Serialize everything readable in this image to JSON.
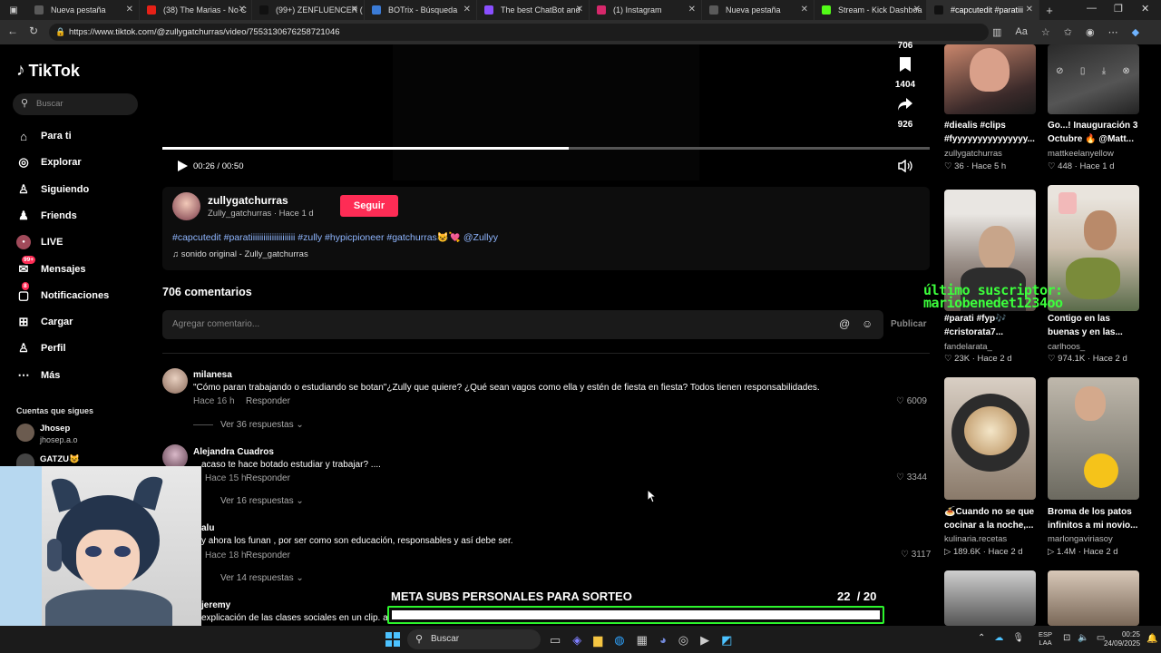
{
  "browser": {
    "tabs": [
      {
        "label": "Nueva pestaña",
        "color": "#5a5a5a"
      },
      {
        "label": "(38) The Marias - No C",
        "color": "#e62117"
      },
      {
        "label": "(99+) ZENFLUENCER (",
        "color": "#111111"
      },
      {
        "label": "BOTrix - Búsqueda",
        "color": "#3b7bd6"
      },
      {
        "label": "The best ChatBot and",
        "color": "#8a4fff"
      },
      {
        "label": "(1) Instagram",
        "color": "#d6286b"
      },
      {
        "label": "Nueva pestaña",
        "color": "#5a5a5a"
      },
      {
        "label": "Stream - Kick Dashboa",
        "color": "#53fc18"
      },
      {
        "label": "#capcutedit #paratiii",
        "color": "#111111"
      }
    ],
    "url": "https://www.tiktok.com/@zullygatchurras/video/7553130676258721046"
  },
  "sidebar": {
    "logo": "TikTok",
    "search_placeholder": "Buscar",
    "items": [
      {
        "label": "Para ti",
        "icon": "home-icon"
      },
      {
        "label": "Explorar",
        "icon": "compass-icon"
      },
      {
        "label": "Siguiendo",
        "icon": "following-icon"
      },
      {
        "label": "Friends",
        "icon": "friends-icon"
      },
      {
        "label": "LIVE",
        "icon": "live-icon"
      },
      {
        "label": "Mensajes",
        "icon": "messages-icon",
        "badge": "99+"
      },
      {
        "label": "Notificaciones",
        "icon": "notifications-icon",
        "badge": "8"
      },
      {
        "label": "Cargar",
        "icon": "upload-icon"
      },
      {
        "label": "Perfil",
        "icon": "profile-icon"
      },
      {
        "label": "Más",
        "icon": "more-icon"
      }
    ],
    "following_header": "Cuentas que sigues",
    "following": [
      {
        "name": "Jhosep",
        "handle": "jhosep.a.o"
      },
      {
        "name": "GATZU😺",
        "handle": ""
      }
    ]
  },
  "video": {
    "time_current": "00:26",
    "time_total": "00:50",
    "progress": 0.53,
    "side_counts": {
      "top": "706",
      "bookmarks": "1404",
      "shares": "926"
    }
  },
  "post": {
    "author": "zullygatchurras",
    "subline": "Zully_gatchurras · Hace 1 d",
    "follow_label": "Seguir",
    "caption": "#capcutedit #paratiiiiiiiiiiiiiiiiiiiii #zully #hypicpioneer #gatchurras😺💘 @Zullyy",
    "sound": "sonido original - Zully_gatchurras"
  },
  "comments": {
    "header": "706 comentarios",
    "input_placeholder": "Agregar comentario...",
    "publish_label": "Publicar",
    "reply_label": "Responder",
    "items": [
      {
        "name": "milanesa",
        "text": "\"Cómo paran trabajando o estudiando se botan\"¿Zully que quiere? ¿Qué sean vagos como ella y estén de fiesta en fiesta? Todos tienen responsabilidades.",
        "time": "Hace 16 h",
        "likes": "6009",
        "replies": "Ver 36 respuestas"
      },
      {
        "name": "Alejandra Cuadros",
        "text": "acaso te hace botado estudiar y trabajar? ....",
        "time": "Hace 15 h",
        "likes": "3344",
        "replies": "Ver 16 respuestas"
      },
      {
        "name": "alu",
        "text": "y ahora los funan , por ser como son educación, responsables y así debe ser.",
        "time": "Hace 18 h",
        "likes": "3117",
        "replies": "Ver 14 respuestas"
      },
      {
        "name": "jeremy",
        "text": "explicación de las clases sociales en un clip. ahí entendemos su la gente con clase Brisero no mezclada · toda la razón",
        "time": "",
        "likes": "",
        "replies": ""
      }
    ]
  },
  "related": [
    {
      "title": "#diealis #clips #fyyyyyyyyyyyyyyy...",
      "author": "zullygatchurras",
      "views": "36",
      "age": "Hace 5 h"
    },
    {
      "title": "Go...! Inauguración 3 Octubre 🔥 @Matt...",
      "author": "mattkeelanyellow",
      "views": "448",
      "age": "Hace 1 d"
    },
    {
      "title": "#parati #fyp🎶 #cristorata7...",
      "author": "fandelarata_",
      "views": "23K",
      "age": "Hace 2 d"
    },
    {
      "title": "Contigo en las buenas y en las...",
      "author": "carlhoos_",
      "views": "974.1K",
      "age": "Hace 2 d"
    },
    {
      "title": "🍝Cuando no se que cocinar a la noche,...",
      "author": "kulinaria.recetas",
      "views": "189.6K",
      "age": "Hace 2 d"
    },
    {
      "title": "Broma de los patos infinitos a mi novio...",
      "author": "marlongaviriasoy",
      "views": "1.4M",
      "age": "Hace 2 d"
    }
  ],
  "overlay": {
    "subscriber_text_1": "último suscriptor:",
    "subscriber_text_2": "mariobenedet1234oo",
    "goal_label": "META SUBS PERSONALES PARA SORTEO",
    "goal_current": "22",
    "goal_total": "/ 20",
    "goal_progress": 1.0
  },
  "taskbar": {
    "search_label": "Buscar",
    "lang_1": "ESP",
    "lang_2": "LAA",
    "time": "00:25",
    "date": "24/09/2025"
  }
}
